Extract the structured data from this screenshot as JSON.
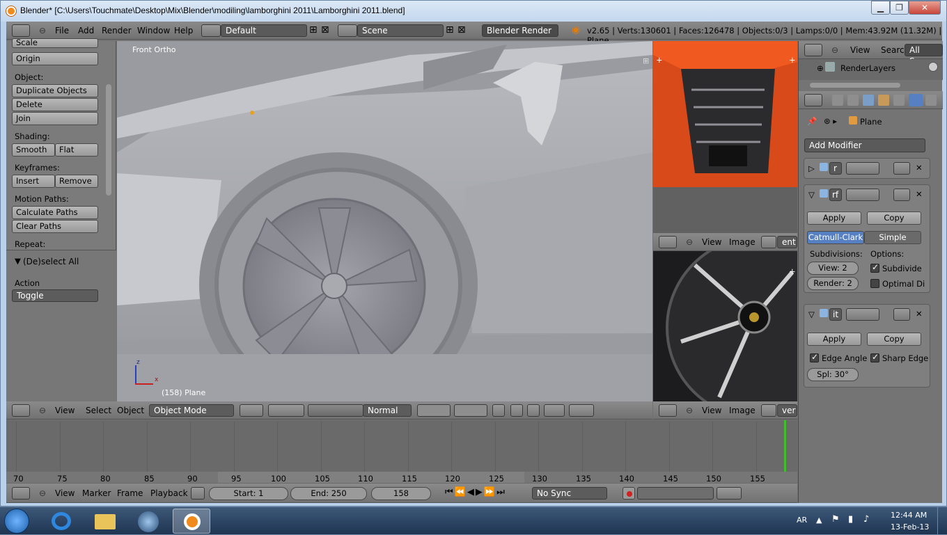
{
  "window": {
    "title": "Blender* [C:\\Users\\Touchmate\\Desktop\\Mix\\Blender\\modiling\\lamborghini 2011\\Lamborghini 2011.blend]"
  },
  "info_header": {
    "menus": [
      "File",
      "Add",
      "Render",
      "Window",
      "Help"
    ],
    "layout": "Default",
    "scene": "Scene",
    "engine": "Blender Render",
    "stats": "v2.65 | Verts:130601 | Faces:126478 | Objects:0/3 | Lamps:0/0 | Mem:43.92M (11.32M) | Plane"
  },
  "toolshelf": {
    "top_buttons": [
      "Scale",
      "Origin"
    ],
    "object_label": "Object:",
    "object_buttons": [
      "Duplicate Objects",
      "Delete",
      "Join"
    ],
    "shading_label": "Shading:",
    "shading": [
      "Smooth",
      "Flat"
    ],
    "keyframes_label": "Keyframes:",
    "keyframes": [
      "Insert",
      "Remove"
    ],
    "motion_label": "Motion Paths:",
    "motion": [
      "Calculate Paths",
      "Clear Paths"
    ],
    "repeat_label": "Repeat:",
    "operator_title": "(De)select All",
    "action_label": "Action",
    "action_value": "Toggle"
  },
  "viewport": {
    "view_name": "Front Ortho",
    "object_info": "(158) Plane",
    "axis_z": "z",
    "axis_x": "x"
  },
  "view3d_header": {
    "menus": [
      "View",
      "Select",
      "Object"
    ],
    "mode": "Object Mode",
    "orientation": "Normal"
  },
  "image_editor_top": {
    "menus": [
      "View",
      "Image"
    ],
    "image_name": "ent"
  },
  "image_editor_bottom": {
    "menus": [
      "View",
      "Image"
    ],
    "image_name": "ver"
  },
  "outliner": {
    "menus": [
      "View",
      "Search"
    ],
    "filter": "All Scene",
    "item": "RenderLayers"
  },
  "properties": {
    "context_object": "Plane",
    "add_modifier": "Add Modifier",
    "mod1_name": "r",
    "mod2_name": "rf",
    "mod2": {
      "apply": "Apply",
      "copy": "Copy",
      "types": [
        "Catmull-Clark",
        "Simple"
      ],
      "subdivisions_label": "Subdivisions:",
      "options_label": "Options:",
      "view": "View: 2",
      "render": "Render: 2",
      "subdivide": "Subdivide",
      "optimal": "Optimal Di"
    },
    "mod3_name": "it",
    "mod3": {
      "apply": "Apply",
      "copy": "Copy",
      "edge_angle": "Edge Angle",
      "sharp_edge": "Sharp Edge",
      "split": "Spl: 30°"
    }
  },
  "timeline": {
    "ticks": [
      "70",
      "75",
      "80",
      "85",
      "90",
      "95",
      "100",
      "105",
      "110",
      "115",
      "120",
      "125",
      "130",
      "135",
      "140",
      "145",
      "150",
      "155"
    ],
    "current_frame_marker": 158
  },
  "timeline_header": {
    "menus": [
      "View",
      "Marker",
      "Frame",
      "Playback"
    ],
    "start": "Start: 1",
    "end": "End: 250",
    "current": "158",
    "sync": "No Sync"
  },
  "taskbar": {
    "lang": "AR",
    "time": "12:44 AM",
    "date": "13-Feb-13"
  },
  "colors": {
    "accent_blue": "#5680c2",
    "timeline_cursor": "#3fbf2a",
    "orange": "#f08a1c"
  }
}
